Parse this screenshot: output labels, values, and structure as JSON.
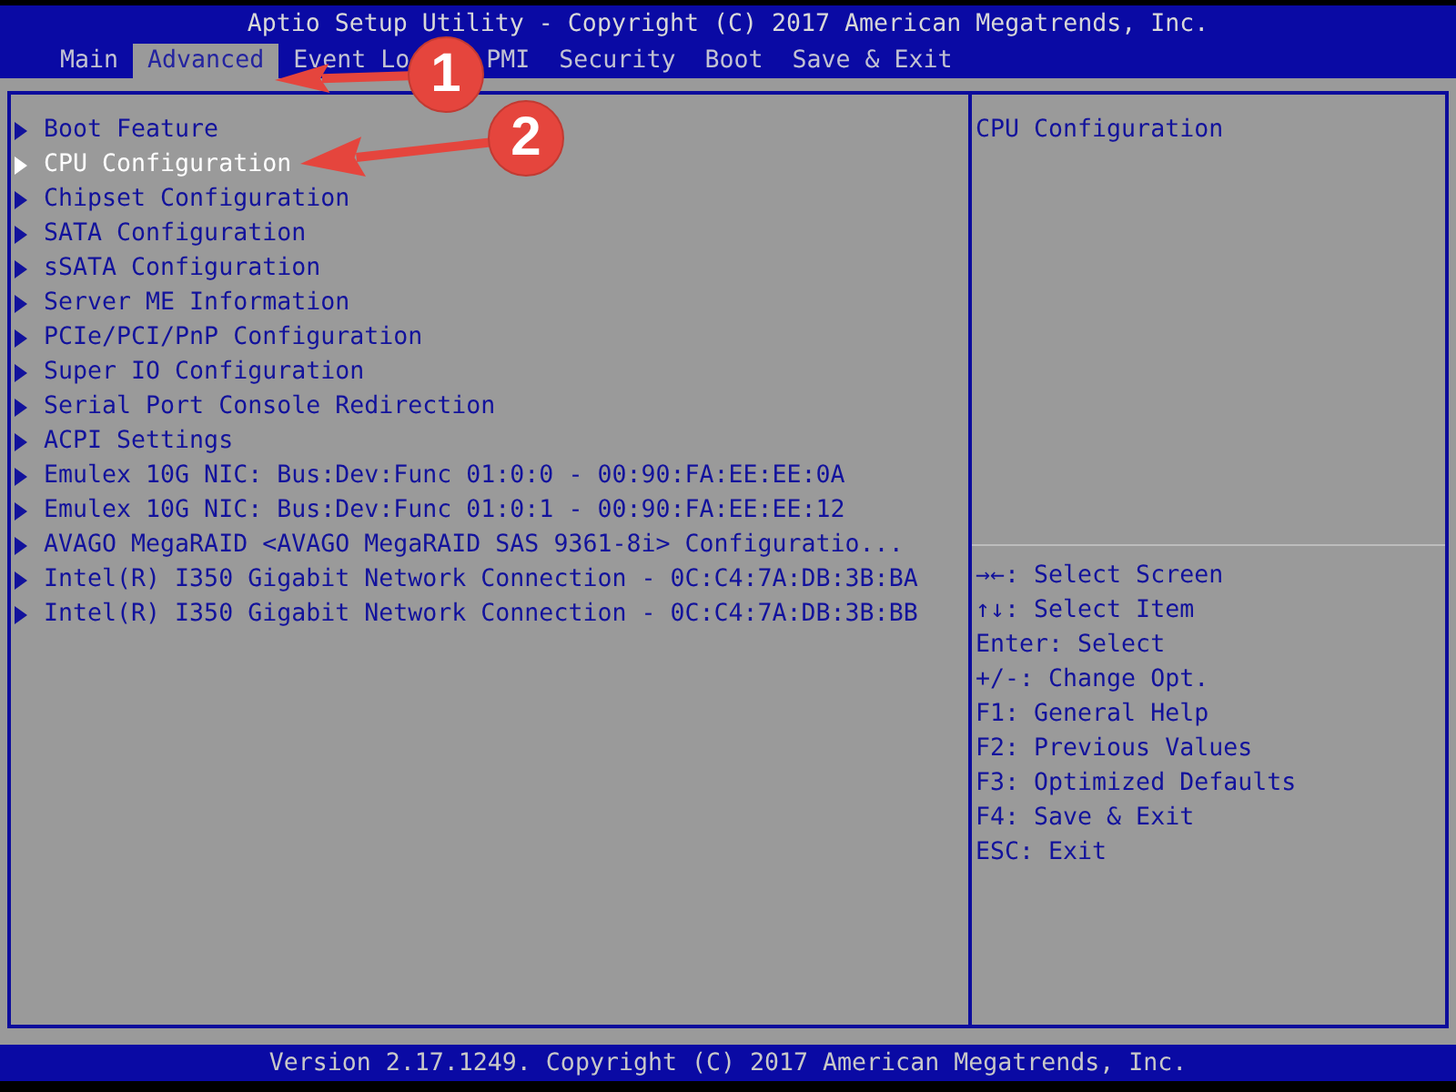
{
  "title_bar": {
    "title": "Aptio Setup Utility - Copyright (C) 2017 American Megatrends, Inc."
  },
  "tabs": [
    {
      "label": "Main",
      "selected": false
    },
    {
      "label": "Advanced",
      "selected": true
    },
    {
      "label": "Event Lo",
      "selected": false
    },
    {
      "label": "PMI",
      "selected": false
    },
    {
      "label": "Security",
      "selected": false
    },
    {
      "label": "Boot",
      "selected": false
    },
    {
      "label": "Save & Exit",
      "selected": false
    }
  ],
  "menu_items": [
    {
      "label": "Boot Feature",
      "selected": false
    },
    {
      "label": "CPU Configuration",
      "selected": true
    },
    {
      "label": "Chipset Configuration",
      "selected": false
    },
    {
      "label": "SATA Configuration",
      "selected": false
    },
    {
      "label": "sSATA Configuration",
      "selected": false
    },
    {
      "label": "Server ME Information",
      "selected": false
    },
    {
      "label": "PCIe/PCI/PnP Configuration",
      "selected": false
    },
    {
      "label": "Super IO Configuration",
      "selected": false
    },
    {
      "label": "Serial Port Console Redirection",
      "selected": false
    },
    {
      "label": "ACPI Settings",
      "selected": false
    },
    {
      "label": "Emulex 10G NIC: Bus:Dev:Func 01:0:0 - 00:90:FA:EE:EE:0A",
      "selected": false
    },
    {
      "label": "Emulex 10G NIC: Bus:Dev:Func 01:0:1 - 00:90:FA:EE:EE:12",
      "selected": false
    },
    {
      "label": "AVAGO MegaRAID <AVAGO MegaRAID SAS 9361-8i> Configuratio...",
      "selected": false
    },
    {
      "label": "Intel(R) I350 Gigabit Network Connection - 0C:C4:7A:DB:3B:BA",
      "selected": false
    },
    {
      "label": "Intel(R) I350 Gigabit Network Connection - 0C:C4:7A:DB:3B:BB",
      "selected": false
    }
  ],
  "help_panel": {
    "description": "CPU Configuration",
    "key_hints": [
      "→←: Select Screen",
      "↑↓: Select Item",
      "Enter: Select",
      "+/-: Change Opt.",
      "F1: General Help",
      "F2: Previous Values",
      "F3: Optimized Defaults",
      "F4: Save & Exit",
      "ESC: Exit"
    ]
  },
  "annotations": [
    {
      "number": "1"
    },
    {
      "number": "2"
    }
  ],
  "status_bar": {
    "text": "Version 2.17.1249. Copyright (C) 2017 American Megatrends, Inc."
  }
}
